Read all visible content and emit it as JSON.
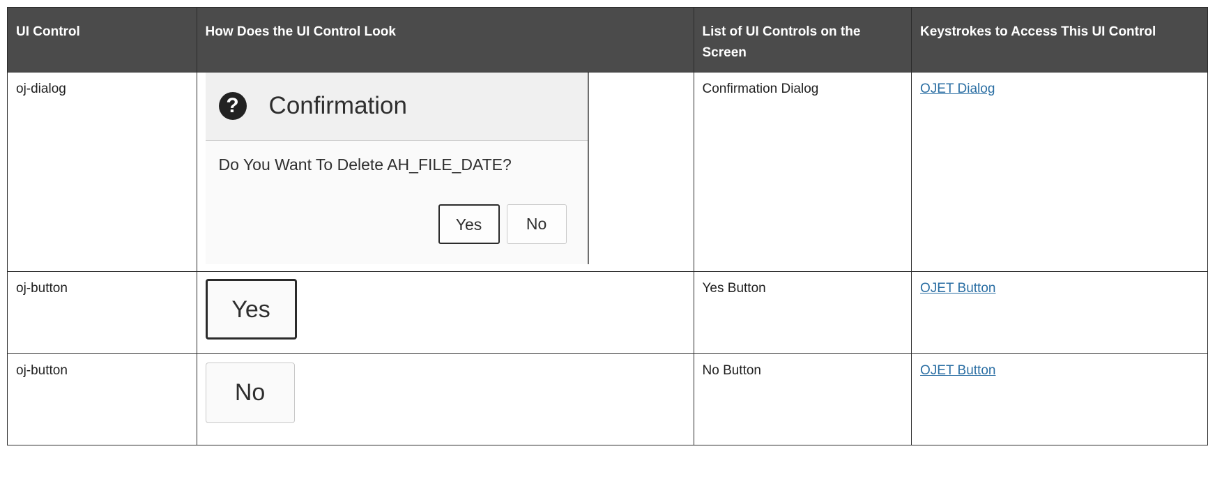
{
  "table": {
    "headers": [
      "UI Control",
      "How Does the UI Control Look",
      "List of UI Controls on the Screen",
      "Keystrokes to Access This UI Control"
    ],
    "rows": [
      {
        "control": "oj-dialog",
        "list": "Confirmation Dialog",
        "link": "OJET Dialog",
        "preview": {
          "icon": "question-circle-icon",
          "title": "Confirmation",
          "message": "Do You Want To Delete AH_FILE_DATE?",
          "yes": "Yes",
          "no": "No"
        }
      },
      {
        "control": "oj-button",
        "list": "Yes Button",
        "link": "OJET Button",
        "preview": {
          "label": "Yes"
        }
      },
      {
        "control": "oj-button",
        "list": "No Button",
        "link": "OJET Button",
        "preview": {
          "label": "No"
        }
      }
    ]
  },
  "colors": {
    "header_bg": "#4b4b4b",
    "header_text": "#ffffff",
    "link": "#2a6ea3",
    "border": "#2b2b2b"
  }
}
